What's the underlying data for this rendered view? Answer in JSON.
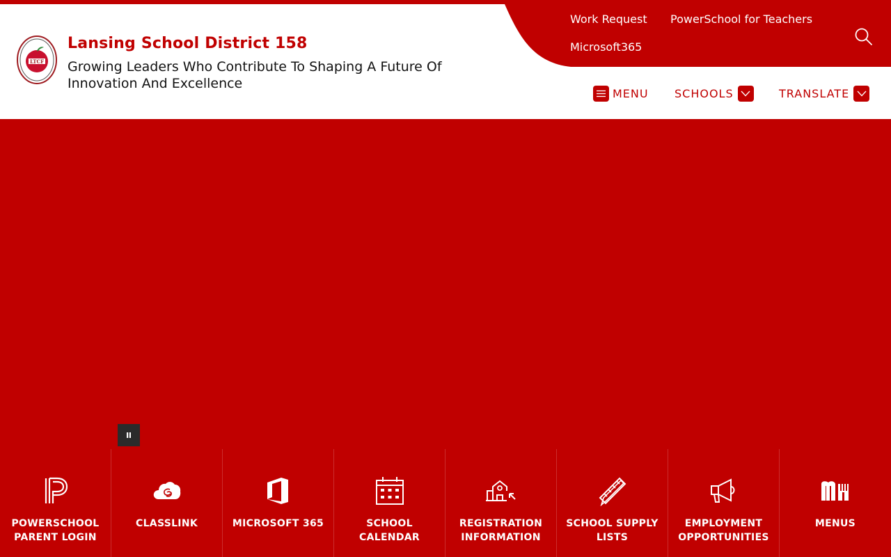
{
  "header": {
    "title": "Lansing School District 158",
    "tagline": "Growing Leaders Who Contribute To Shaping A Future Of Innovation And Excellence"
  },
  "utility_links": [
    {
      "label": "Work Request"
    },
    {
      "label": "PowerSchool for Teachers"
    },
    {
      "label": "Microsoft365"
    }
  ],
  "nav": {
    "menu_label": "MENU",
    "schools_label": "SCHOOLS",
    "translate_label": "TRANSLATE"
  },
  "quicklinks": [
    {
      "label": "POWERSCHOOL PARENT LOGIN",
      "icon": "powerschool-icon"
    },
    {
      "label": "CLASSLINK",
      "icon": "classlink-cloud-icon"
    },
    {
      "label": "MICROSOFT 365",
      "icon": "microsoft-office-icon"
    },
    {
      "label": "SCHOOL CALENDAR",
      "icon": "calendar-icon"
    },
    {
      "label": "REGISTRATION INFORMATION",
      "icon": "school-building-icon"
    },
    {
      "label": "SCHOOL SUPPLY LISTS",
      "icon": "pencil-ruler-icon"
    },
    {
      "label": "EMPLOYMENT OPPORTUNITIES",
      "icon": "megaphone-icon"
    },
    {
      "label": "MENUS",
      "icon": "menus-fork-icon"
    }
  ],
  "colors": {
    "brand_red": "#c00000",
    "header_bg": "#ffffff",
    "pause_bg": "#2b2b2b"
  }
}
